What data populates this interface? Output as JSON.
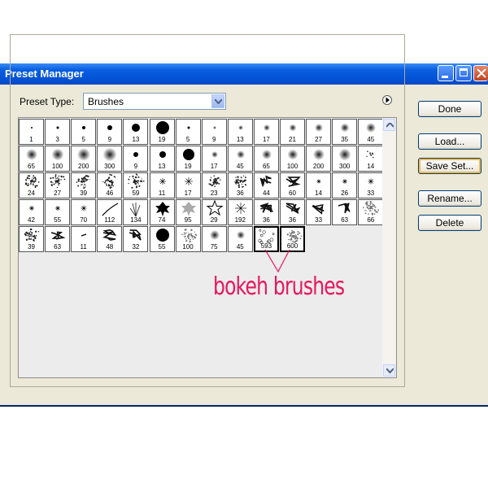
{
  "window": {
    "title": "Preset Manager"
  },
  "preset_type": {
    "label": "Preset Type:",
    "value": "Brushes"
  },
  "buttons": {
    "done": "Done",
    "load": "Load...",
    "save": "Save Set...",
    "rename": "Rename...",
    "delete": "Delete"
  },
  "annotation": "bokeh brushes",
  "colors": {
    "titlebar": "#0453d6",
    "annotation": "#e8175d",
    "dialog": "#ece9d8"
  },
  "brushes": [
    {
      "num": "1",
      "type": "dot",
      "s": 1
    },
    {
      "num": "3",
      "type": "dot",
      "s": 1.5
    },
    {
      "num": "5",
      "type": "dot",
      "s": 2
    },
    {
      "num": "9",
      "type": "dot",
      "s": 3
    },
    {
      "num": "13",
      "type": "dot",
      "s": 5
    },
    {
      "num": "19",
      "type": "dot",
      "s": 8
    },
    {
      "num": "5",
      "type": "dot",
      "s": 1.5
    },
    {
      "num": "9",
      "type": "soft",
      "s": 2
    },
    {
      "num": "13",
      "type": "soft",
      "s": 3
    },
    {
      "num": "17",
      "type": "soft",
      "s": 4
    },
    {
      "num": "21",
      "type": "soft",
      "s": 4.5
    },
    {
      "num": "27",
      "type": "soft",
      "s": 5
    },
    {
      "num": "35",
      "type": "soft",
      "s": 5.5
    },
    {
      "num": "45",
      "type": "soft",
      "s": 6
    },
    {
      "num": "65",
      "type": "soft",
      "s": 7
    },
    {
      "num": "100",
      "type": "soft",
      "s": 7.5
    },
    {
      "num": "200",
      "type": "soft",
      "s": 8
    },
    {
      "num": "300",
      "type": "soft",
      "s": 8.5
    },
    {
      "num": "9",
      "type": "dot",
      "s": 3
    },
    {
      "num": "13",
      "type": "dot",
      "s": 4
    },
    {
      "num": "19",
      "type": "dot",
      "s": 7
    },
    {
      "num": "17",
      "type": "soft",
      "s": 4
    },
    {
      "num": "45",
      "type": "soft",
      "s": 5
    },
    {
      "num": "65",
      "type": "soft",
      "s": 6
    },
    {
      "num": "100",
      "type": "soft",
      "s": 6.5
    },
    {
      "num": "200",
      "type": "soft",
      "s": 7
    },
    {
      "num": "300",
      "type": "soft",
      "s": 7.5
    },
    {
      "num": "14",
      "type": "speck",
      "s": 5
    },
    {
      "num": "24",
      "type": "splat",
      "s": 8
    },
    {
      "num": "27",
      "type": "splat",
      "s": 8
    },
    {
      "num": "39",
      "type": "splat",
      "s": 8
    },
    {
      "num": "46",
      "type": "splat",
      "s": 8
    },
    {
      "num": "59",
      "type": "splat",
      "s": 9
    },
    {
      "num": "11",
      "type": "star",
      "s": 4
    },
    {
      "num": "17",
      "type": "star",
      "s": 5
    },
    {
      "num": "23",
      "type": "splat",
      "s": 7
    },
    {
      "num": "36",
      "type": "splat",
      "s": 7
    },
    {
      "num": "44",
      "type": "scribble",
      "s": 8
    },
    {
      "num": "60",
      "type": "scribble",
      "s": 8
    },
    {
      "num": "14",
      "type": "star",
      "s": 2.5
    },
    {
      "num": "26",
      "type": "star",
      "s": 3
    },
    {
      "num": "33",
      "type": "star",
      "s": 3.5
    },
    {
      "num": "42",
      "type": "star",
      "s": 3
    },
    {
      "num": "55",
      "type": "star",
      "s": 3
    },
    {
      "num": "70",
      "type": "star",
      "s": 3.5
    },
    {
      "num": "112",
      "type": "stroke",
      "s": 8
    },
    {
      "num": "134",
      "type": "grass",
      "s": 9
    },
    {
      "num": "74",
      "type": "leaf",
      "s": 7
    },
    {
      "num": "95",
      "type": "leafgray",
      "s": 7
    },
    {
      "num": "29",
      "type": "starshape",
      "s": 8
    },
    {
      "num": "192",
      "type": "spark",
      "s": 7
    },
    {
      "num": "36",
      "type": "scribble",
      "s": 8
    },
    {
      "num": "36",
      "type": "scribble",
      "s": 8
    },
    {
      "num": "33",
      "type": "scribble",
      "s": 8
    },
    {
      "num": "63",
      "type": "scribble",
      "s": 8
    },
    {
      "num": "66",
      "type": "texture",
      "s": 8
    },
    {
      "num": "39",
      "type": "splat",
      "s": 8
    },
    {
      "num": "63",
      "type": "scribble",
      "s": 8
    },
    {
      "num": "11",
      "type": "dash",
      "s": 4
    },
    {
      "num": "48",
      "type": "scribble",
      "s": 8
    },
    {
      "num": "32",
      "type": "scribble",
      "s": 8
    },
    {
      "num": "55",
      "type": "dot",
      "s": 8
    },
    {
      "num": "100",
      "type": "texture",
      "s": 8
    },
    {
      "num": "75",
      "type": "soft",
      "s": 6
    },
    {
      "num": "45",
      "type": "soft",
      "s": 5
    },
    {
      "num": "593",
      "type": "bokeh",
      "s": 8,
      "sel": true
    },
    {
      "num": "600",
      "type": "bokehtex",
      "s": 8,
      "sel": true
    }
  ]
}
